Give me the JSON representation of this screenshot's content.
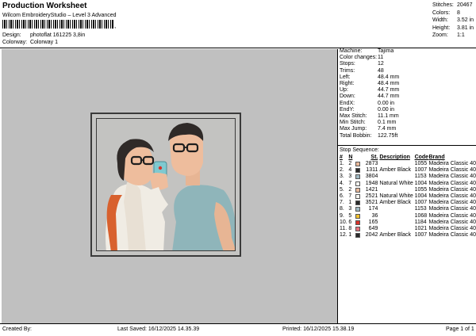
{
  "header": {
    "title": "Production Worksheet",
    "software": "Wilcom EmbroideryStudio – Level 3 Advanced",
    "design_label": "Design:",
    "design_value": "photoflat 161225 3,8in",
    "colorway_label": "Colorway:",
    "colorway_value": "Colorway 1",
    "barcode_tail": ","
  },
  "summary": [
    {
      "k": "Stitches:",
      "v": "20467"
    },
    {
      "k": "Colors:",
      "v": "8"
    },
    {
      "k": "Width:",
      "v": "3.52 in"
    },
    {
      "k": "Height:",
      "v": "3.81 in"
    },
    {
      "k": "Zoom:",
      "v": "1:1"
    }
  ],
  "details": [
    {
      "k": "Machine:",
      "v": "Tajima"
    },
    {
      "k": "Color changes:",
      "v": "11"
    },
    {
      "k": "Stops:",
      "v": "12"
    },
    {
      "k": "Trims:",
      "v": "48"
    },
    {
      "k": "Left:",
      "v": "48.4 mm"
    },
    {
      "k": "Right:",
      "v": "48.4 mm"
    },
    {
      "k": "Up:",
      "v": "44.7 mm"
    },
    {
      "k": "Down:",
      "v": "44.7 mm"
    },
    {
      "k": "EndX:",
      "v": "0.00 in"
    },
    {
      "k": "EndY:",
      "v": "0.00 in"
    },
    {
      "k": "Max Stitch:",
      "v": "11.1 mm"
    },
    {
      "k": "Min Stitch:",
      "v": "0.1 mm"
    },
    {
      "k": "Max Jump:",
      "v": "7.4 mm"
    },
    {
      "k": "Total Bobbin:",
      "v": "122.75ft"
    }
  ],
  "stop_sequence": {
    "title": "Stop Sequence:",
    "headers": [
      "#",
      "N",
      "St.",
      "Description",
      "Code",
      "Brand"
    ],
    "rows": [
      {
        "n": "1.",
        "needle": "2",
        "color": "#e8b89a",
        "st": "2873",
        "desc": "",
        "code": "1055",
        "brand": "Madeira Classic 40"
      },
      {
        "n": "2.",
        "needle": "4",
        "color": "#2a2a2a",
        "st": "1311",
        "desc": "Amber Black",
        "code": "1007",
        "brand": "Madeira Classic 40"
      },
      {
        "n": "3.",
        "needle": "3",
        "color": "#9fb8c2",
        "st": "3804",
        "desc": "",
        "code": "1153",
        "brand": "Madeira Classic 40"
      },
      {
        "n": "4.",
        "needle": "7",
        "color": "#f4f4f0",
        "st": "1948",
        "desc": "Natural White",
        "code": "1004",
        "brand": "Madeira Classic 40"
      },
      {
        "n": "5.",
        "needle": "2",
        "color": "#e8b89a",
        "st": "1421",
        "desc": "",
        "code": "1055",
        "brand": "Madeira Classic 40"
      },
      {
        "n": "6.",
        "needle": "7",
        "color": "#f4f4f0",
        "st": "2521",
        "desc": "Natural White",
        "code": "1004",
        "brand": "Madeira Classic 40"
      },
      {
        "n": "7.",
        "needle": "1",
        "color": "#2a2a2a",
        "st": "3521",
        "desc": "Amber Black",
        "code": "1007",
        "brand": "Madeira Classic 40"
      },
      {
        "n": "8.",
        "needle": "3",
        "color": "#9fb8c2",
        "st": "174",
        "desc": "",
        "code": "1153",
        "brand": "Madeira Classic 40"
      },
      {
        "n": "9.",
        "needle": "5",
        "color": "#f2c22e",
        "st": "36",
        "desc": "",
        "code": "1068",
        "brand": "Madeira Classic 40"
      },
      {
        "n": "10.",
        "needle": "6",
        "color": "#d8322a",
        "st": "165",
        "desc": "",
        "code": "1184",
        "brand": "Madeira Classic 40"
      },
      {
        "n": "11.",
        "needle": "8",
        "color": "#e8707a",
        "st": "649",
        "desc": "",
        "code": "1021",
        "brand": "Madeira Classic 40"
      },
      {
        "n": "12.",
        "needle": "1",
        "color": "#2a2a2a",
        "st": "2042",
        "desc": "Amber Black",
        "code": "1007",
        "brand": "Madeira Classic 40"
      }
    ]
  },
  "footer": {
    "created": "Created By:",
    "saved": "Last Saved: 16/12/2025 14.35.39",
    "printed": "Printed: 16/12/2025 15.38.19",
    "page": "Page 1 of 1"
  },
  "colors": {
    "canvas_bg": "#c0c0c0",
    "frame": "#3a3a3a"
  }
}
